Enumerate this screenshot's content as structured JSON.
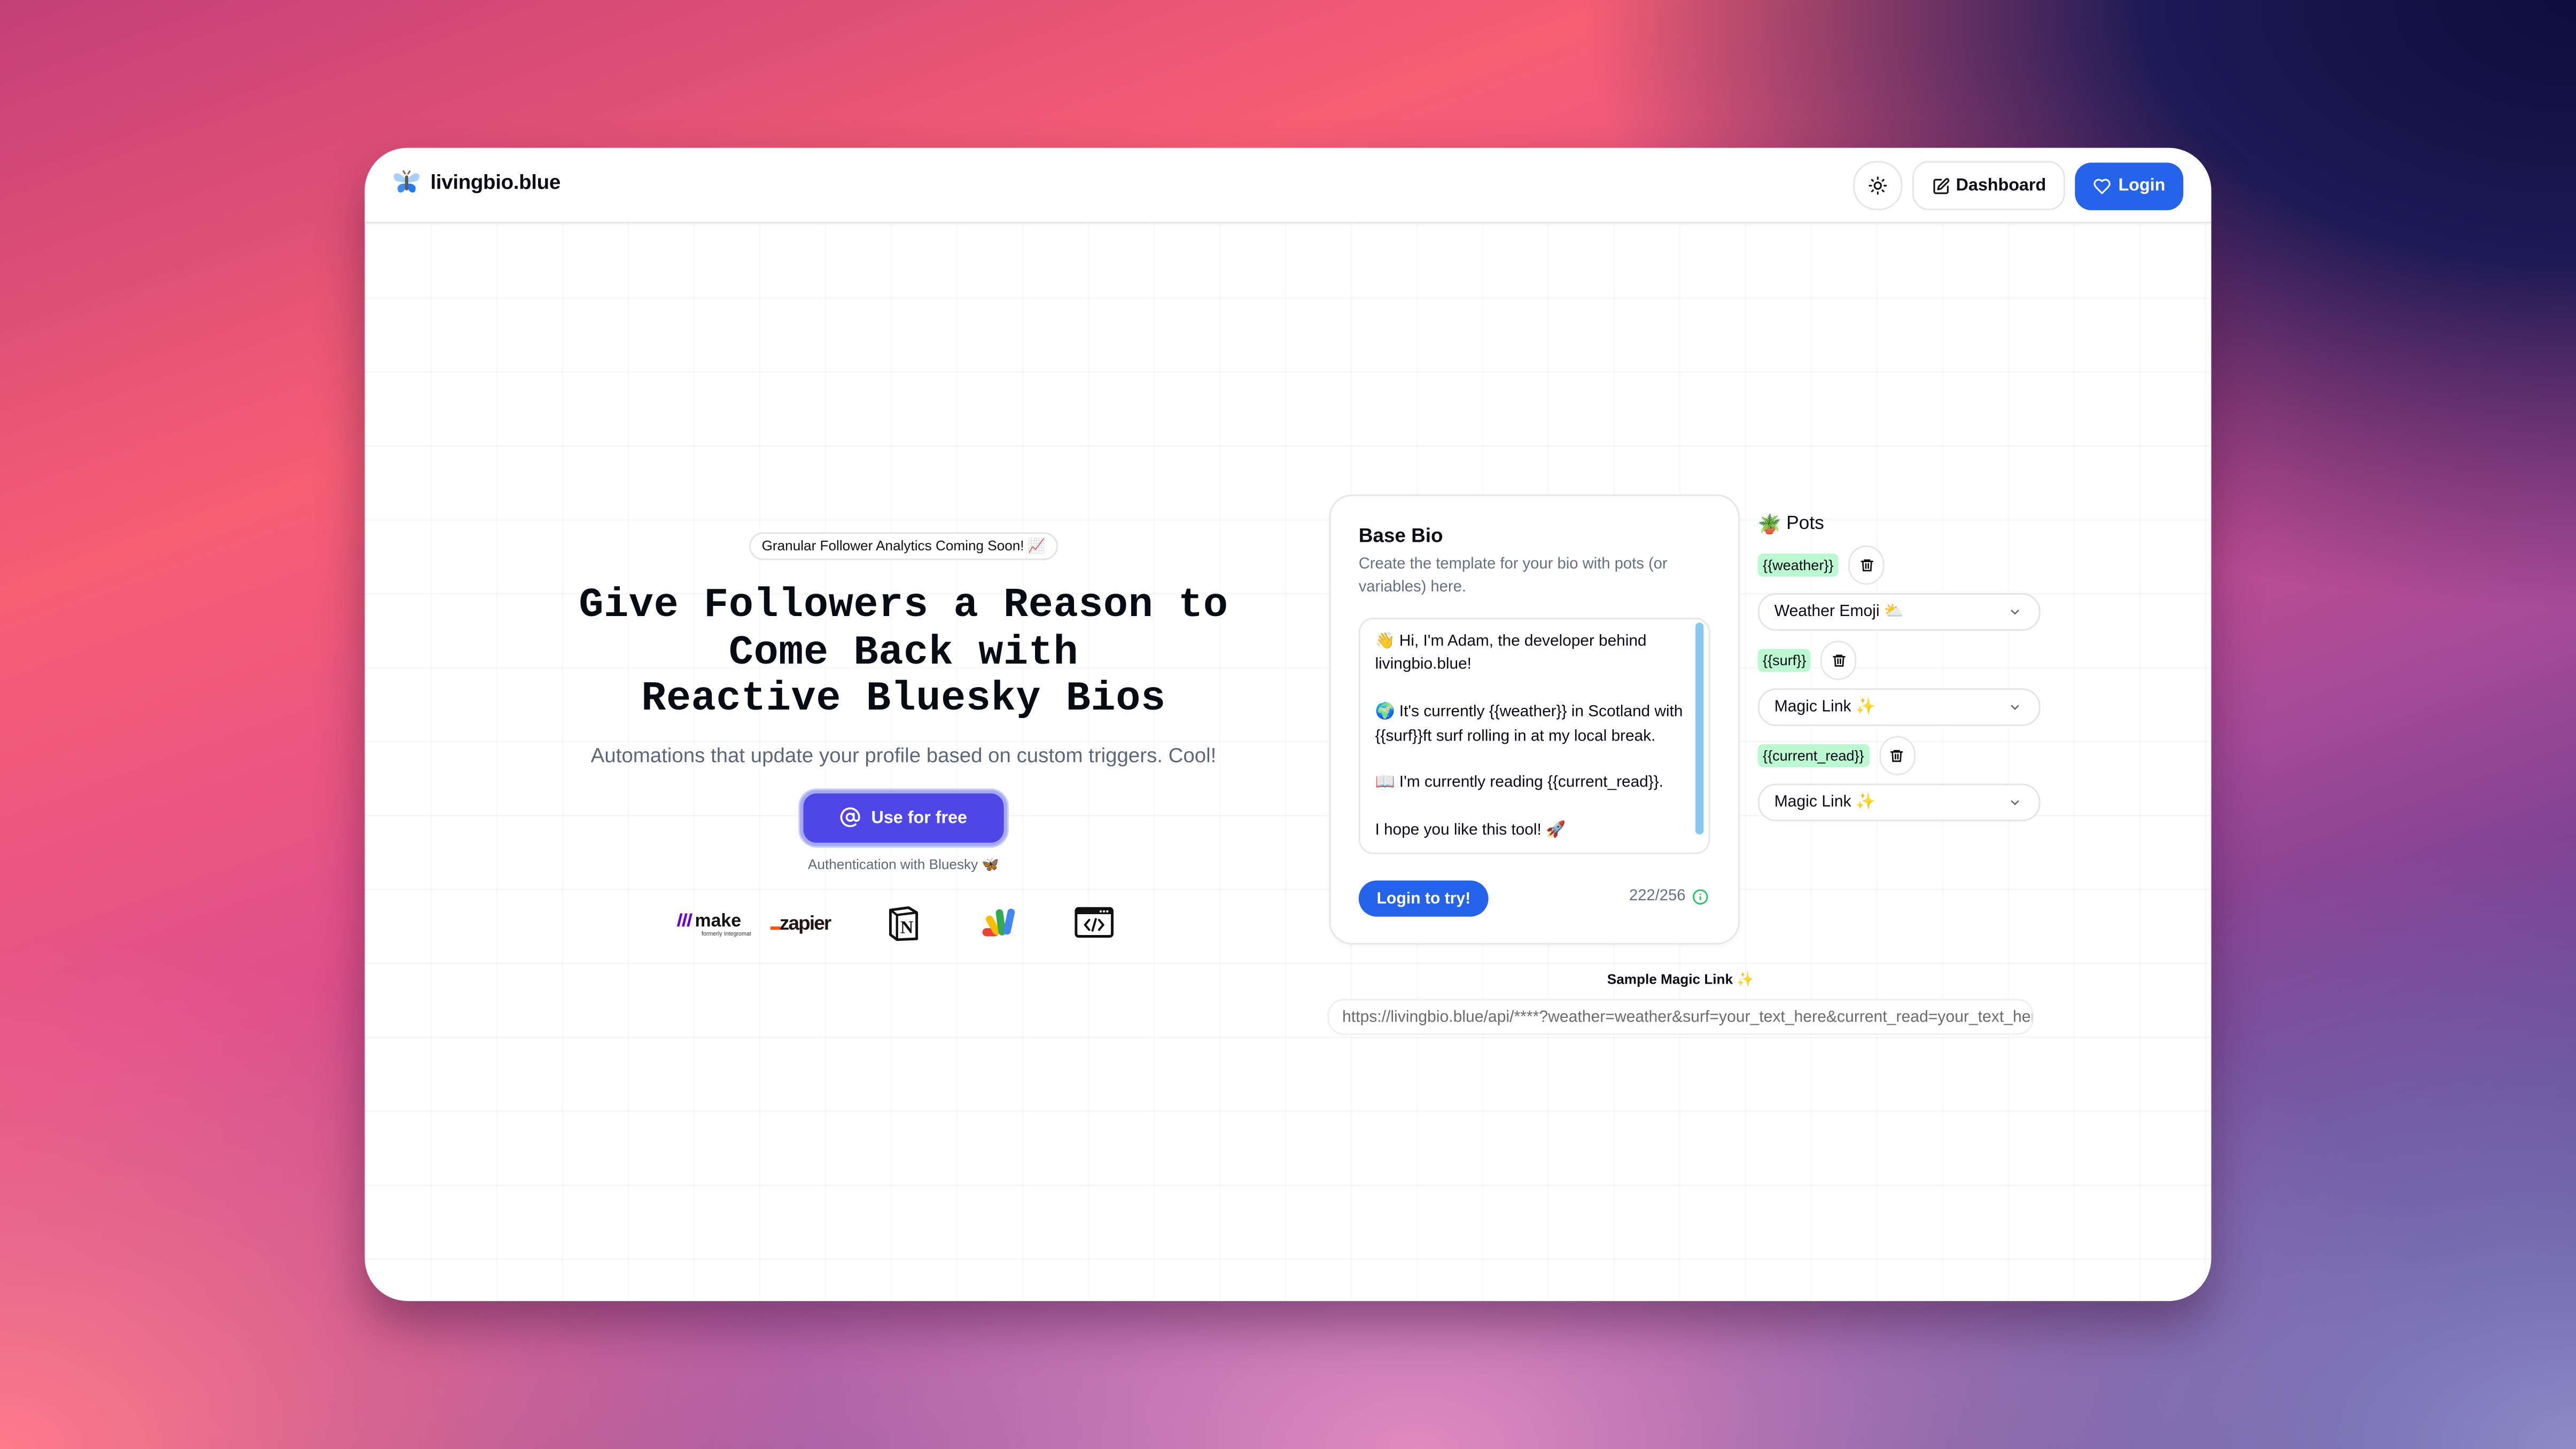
{
  "navbar": {
    "brand_name": "livingbio.blue",
    "brand_icon": "butterfly-icon",
    "theme_toggle_icon": "sun-icon",
    "dashboard_label": "Dashboard",
    "dashboard_icon": "edit-square-icon",
    "login_label": "Login",
    "login_icon": "heart-icon"
  },
  "hero": {
    "announcement": "Granular Follower Analytics Coming Soon! 📈",
    "headline_lines": [
      "Give Followers a Reason to",
      "Come Back with"
    ],
    "headline_highlight": "Reactive Bluesky Bios",
    "subtitle": "Automations that update your profile based on custom triggers. Cool!",
    "cta_label": "Use for free",
    "cta_icon": "at-sign-icon",
    "auth_note": "Authentication with Bluesky 🦋",
    "integrations": [
      {
        "name": "make",
        "label": "make",
        "sublabel": "formerly Integromat"
      },
      {
        "name": "zapier",
        "label": "zapier"
      },
      {
        "name": "notion",
        "label": "N"
      },
      {
        "name": "google-apps-script",
        "label": ""
      },
      {
        "name": "custom-code",
        "label": "</>"
      }
    ]
  },
  "base_bio": {
    "title": "Base Bio",
    "description": "Create the template for your bio with pots (or variables) here.",
    "bio_text": "👋 Hi, I'm Adam, the developer behind livingbio.blue!\n\n🌍 It's currently {{weather}} in Scotland with {{surf}}ft surf rolling in at my local break.\n\n📖 I'm currently reading {{current_read}}.\n\nI hope you like this tool! 🚀",
    "login_button": "Login to try!",
    "char_count": "222/256",
    "char_count_status_icon": "info-circle-icon",
    "status_color": "#22c55e"
  },
  "pots": {
    "title": "Pots",
    "title_icon": "🪴",
    "items": [
      {
        "tag": "{{weather}}",
        "source": "Weather Emoji ⛅"
      },
      {
        "tag": "{{surf}}",
        "source": "Magic Link ✨"
      },
      {
        "tag": "{{current_read}}",
        "source": "Magic Link ✨"
      }
    ]
  },
  "magic_link": {
    "label": "Sample Magic Link ✨",
    "value": "https://livingbio.blue/api/****?weather=weather&surf=your_text_here&current_read=your_text_here"
  },
  "colors": {
    "primary": "#2563eb",
    "cta": "#4f46e5",
    "pot_tag_bg": "#bbf7d0",
    "highlight_from": "#7dd3fc",
    "highlight_to": "#06b6d4"
  }
}
